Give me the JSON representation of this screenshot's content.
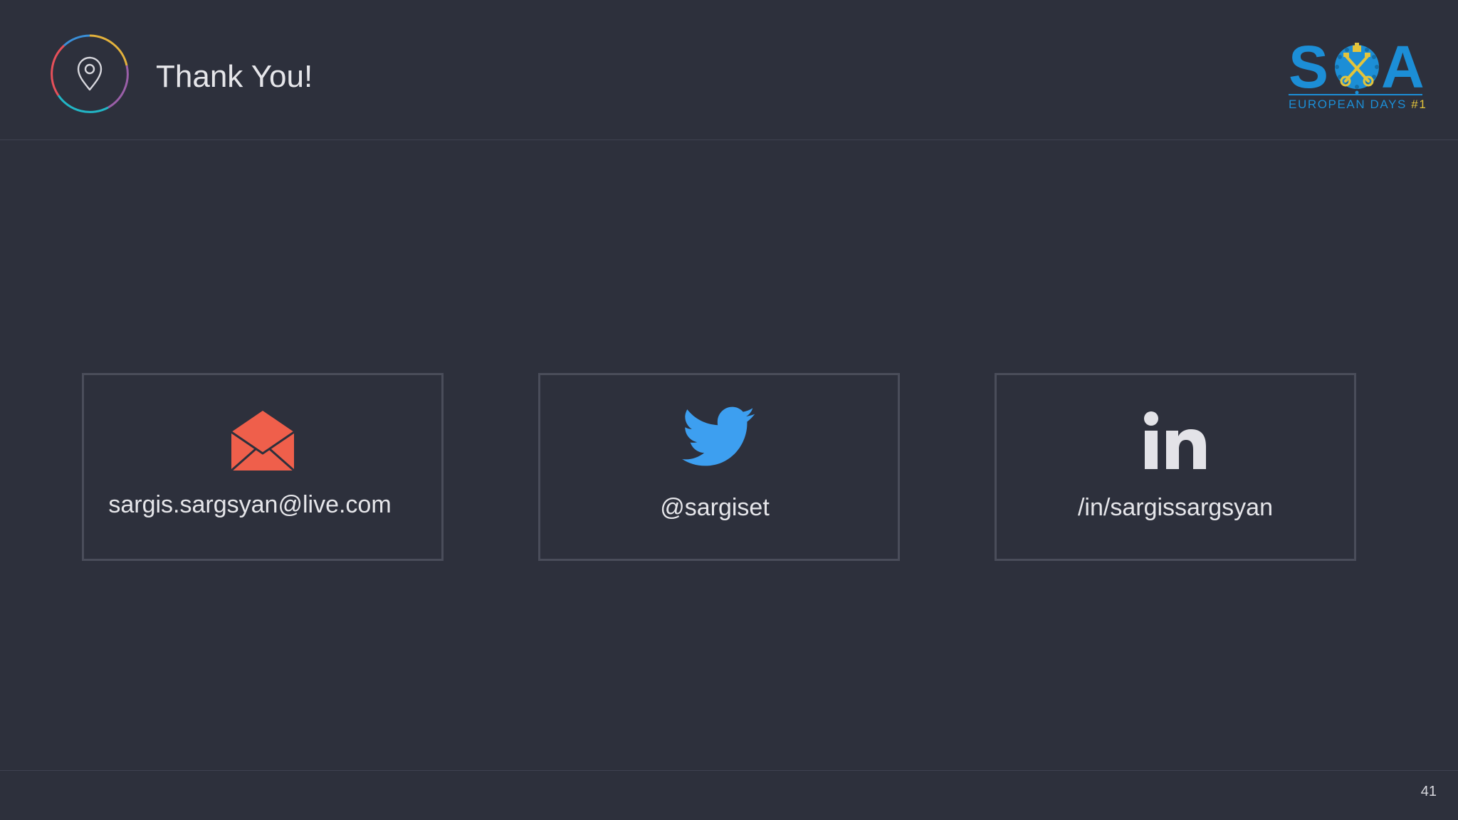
{
  "slide": {
    "title": "Thank You!",
    "page_number": "41"
  },
  "logo": {
    "letter_left": "S",
    "letter_right": "A",
    "subtitle": "EUROPEAN DAYS",
    "subtitle_number": "#1"
  },
  "contacts": {
    "email": {
      "text": "sargis.sargsyan@live.com",
      "icon": "envelope-icon"
    },
    "twitter": {
      "text": "@sargiset",
      "icon": "twitter-bird-icon"
    },
    "linkedin": {
      "text": "/in/sargissargsyan",
      "icon": "linkedin-icon"
    }
  },
  "colors": {
    "background": "#2d303c",
    "email_icon": "#ef5f4b",
    "twitter_icon": "#3d9ff0",
    "linkedin_icon": "#e3e3e8",
    "logo_blue": "#1c8ed6",
    "logo_gold": "#e3c43b"
  }
}
